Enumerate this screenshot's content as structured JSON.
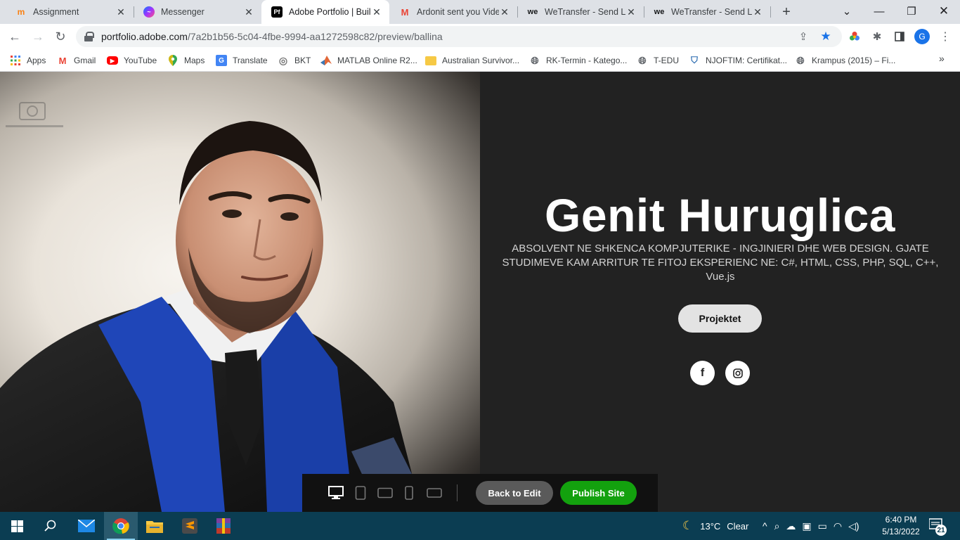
{
  "browser": {
    "tabs": [
      {
        "title": "Assignment",
        "icon": "moodle-icon"
      },
      {
        "title": "Messenger",
        "icon": "messenger-icon"
      },
      {
        "title": "Adobe Portfolio | Build",
        "icon": "adobe-portfolio-icon",
        "active": true
      },
      {
        "title": "Ardonit sent you Vide",
        "icon": "gmail-icon"
      },
      {
        "title": "WeTransfer - Send Lar",
        "icon": "wetransfer-icon"
      },
      {
        "title": "WeTransfer - Send Lar",
        "icon": "wetransfer-icon"
      }
    ],
    "url_host": "portfolio.adobe.com",
    "url_path": "/7a2b1b56-5c04-4fbe-9994-aa1272598c82/preview/ballina",
    "profile_initial": "G",
    "bookmarks": [
      {
        "label": "Apps"
      },
      {
        "label": "Gmail"
      },
      {
        "label": "YouTube"
      },
      {
        "label": "Maps"
      },
      {
        "label": "Translate"
      },
      {
        "label": "BKT"
      },
      {
        "label": "MATLAB Online R2..."
      },
      {
        "label": "Australian Survivor..."
      },
      {
        "label": "RK-Termin - Katego..."
      },
      {
        "label": "T-EDU"
      },
      {
        "label": "NJOFTIM: Certifikat..."
      },
      {
        "label": "Krampus (2015) – Fi..."
      }
    ],
    "more_bookmarks": "»"
  },
  "page": {
    "name": "Genit Huruglica",
    "description": "ABSOLVENT NE SHKENCA KOMPJUTERIKE - INGJINIERI DHE WEB DESIGN. GJATE STUDIMEVE KAM ARRITUR TE FITOJ EKSPERIENC NE: C#, HTML, CSS, PHP,  SQL, C++, Vue.js",
    "projects_button": "Projektet",
    "social": [
      "facebook-icon",
      "instagram-icon"
    ]
  },
  "preview_bar": {
    "back_label": "Back to Edit",
    "publish_label": "Publish Site",
    "devices": [
      "desktop-icon",
      "tablet-portrait-icon",
      "tablet-landscape-icon",
      "phone-portrait-icon",
      "phone-landscape-icon"
    ]
  },
  "taskbar": {
    "weather_temp": "13°C",
    "weather_desc": "Clear",
    "time": "6:40 PM",
    "date": "5/13/2022",
    "notification_count": "21"
  },
  "colors": {
    "page_bg": "#222222",
    "publish_green": "#13a10e",
    "taskbar": "#0b3d52"
  }
}
